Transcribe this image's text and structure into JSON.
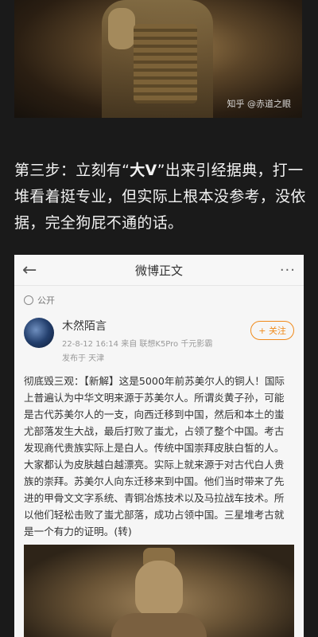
{
  "top_image": {
    "watermark": "知乎 @赤道之眼"
  },
  "caption": {
    "prefix": "第三步：立刻有“",
    "highlight": "大V",
    "suffix": "”出来引经据典，打一堆看着挺专业，但实际上根本没参考，没依据，完全狗屁不通的话。"
  },
  "weibo": {
    "nav": {
      "back": "←",
      "title": "微博正文",
      "more": "···"
    },
    "visibility": "公开",
    "user": {
      "name": "木然陌言",
      "meta": "22-8-12 16:14  来自 联想K5Pro 千元影霸",
      "location": "发布于 天津"
    },
    "follow_label": "+ 关注",
    "post_text": "彻底毁三观：【新解】这是5000年前苏美尔人的铜人！国际上普遍认为中华文明来源于苏美尔人。所谓炎黄子孙，可能是古代苏美尔人的一支，向西迁移到中国，然后和本土的蚩尤部落发生大战，最后打败了蚩尤，占领了整个中国。考古发现商代贵族实际上是白人。传统中国崇拜皮肤白皙的人。大家都认为皮肤越白越漂亮。实际上就来源于对古代白人贵族的崇拜。苏美尔人向东迁移来到中国。他们当时带来了先进的甲骨文文字系统、青铜冶炼技术以及马拉战车技术。所以他们轻松击败了蚩尤部落，成功占领中国。三星堆考古就是一个有力的证明。(转)"
  }
}
